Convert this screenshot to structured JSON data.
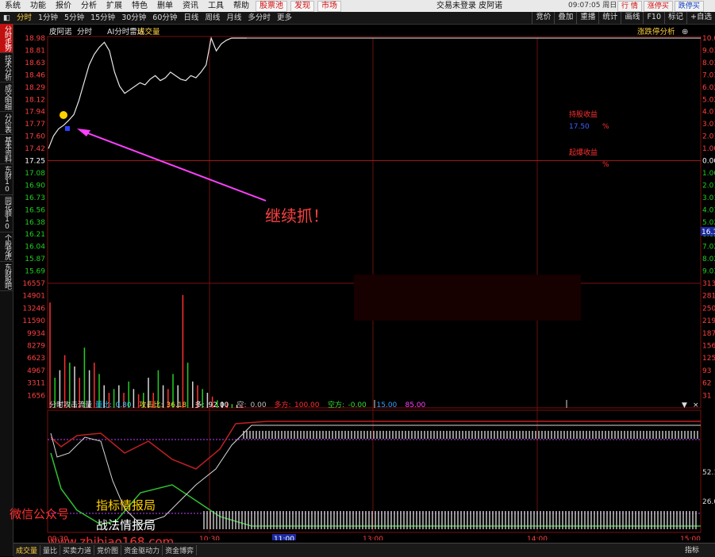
{
  "menu": [
    "系统",
    "功能",
    "报价",
    "分析",
    "扩展",
    "特色",
    "删单",
    "资讯",
    "工具",
    "帮助"
  ],
  "menu_highlights": [
    "股票池",
    "发现",
    "市场"
  ],
  "window_title": "交易未登录  皮阿诺",
  "clock": "09:07:05 周日",
  "window_buttons": [
    "行 情",
    "涨停买",
    "跌停买"
  ],
  "toolbar": [
    "分时",
    "1分钟",
    "5分钟",
    "15分钟",
    "30分钟",
    "60分钟",
    "日线",
    "周线",
    "月线",
    "多分时",
    "更多"
  ],
  "toolbar_right": [
    "竞价",
    "叠加",
    "重播",
    "统计",
    "画线",
    "F10",
    "标记",
    "+自选"
  ],
  "sidebar": [
    "分时走势",
    "技术分析",
    "成交明细",
    "分价表",
    "基本资料",
    "东财10",
    "同花顺10",
    "个股龙虎",
    "东财股吧"
  ],
  "header": {
    "stock": "皮阿诺",
    "labels": [
      "分时",
      "AI分时雷达",
      "成交量"
    ],
    "right_label": "涨跌停分析"
  },
  "price_axis": {
    "left": [
      "18.98",
      "18.81",
      "18.63",
      "18.46",
      "18.29",
      "18.12",
      "17.94",
      "17.77",
      "17.60",
      "17.42",
      "17.25",
      "17.08",
      "16.90",
      "16.73",
      "16.56",
      "16.38",
      "16.21",
      "16.04",
      "15.87",
      "15.69"
    ],
    "right": [
      "10.0",
      "9.03",
      "8.03",
      "7.03",
      "6.02",
      "5.02",
      "4.01",
      "3.01",
      "2.01",
      "1.00",
      "0.00",
      "1.00",
      "2.01",
      "3.01",
      "4.01",
      "5.02",
      "6.02",
      "7.02",
      "8.02",
      "9.03"
    ],
    "prev_close": "17.25",
    "cursor_label": "16.1"
  },
  "volume_axis": {
    "left": [
      "16557",
      "14901",
      "13246",
      "11590",
      "9934",
      "8279",
      "6623",
      "4967",
      "3311",
      "1656"
    ],
    "right": [
      "313",
      "281",
      "250",
      "219",
      "187",
      "156",
      "125",
      "93",
      "62",
      "31"
    ]
  },
  "annotations": {
    "cost_label": "持股收益",
    "cost_value": "17.50",
    "cost_pct": "%",
    "rise_label": "起爆收益",
    "rise_pct": "%",
    "overlay": "继续抓！"
  },
  "indicator": {
    "title": "分时攻击流量",
    "items": [
      {
        "label": "量比:",
        "value": "0.80",
        "color": "#30c8ff"
      },
      {
        "label": "攻击比:",
        "value": "36.18",
        "color": "#ffd040"
      },
      {
        "label": "多:",
        "value": "92.00",
        "color": "#ffffff"
      },
      {
        "label": "空:",
        "value": "0.00",
        "color": "#c0c0c0"
      },
      {
        "label": "多方:",
        "value": "100.00",
        "color": "#ff3030"
      },
      {
        "label": "空方:",
        "value": "-0.00",
        "color": "#30e030"
      },
      {
        "label": "",
        "value": "15.00",
        "color": "#30a0ff"
      },
      {
        "label": "",
        "value": "85.00",
        "color": "#ff40ff"
      }
    ],
    "right_axis": [
      "52.1",
      "26.0"
    ]
  },
  "time_axis": [
    "09:30",
    "10:30",
    "11:00",
    "13:00",
    "14:00",
    "15:00"
  ],
  "bottom_tabs": [
    "成交量",
    "量比",
    "买卖力道",
    "竞价图",
    "资金驱动力",
    "资金博弈"
  ],
  "indicator_button": "指标",
  "watermark": {
    "prefix": "微信公众号",
    "line1": "指标情报局",
    "line2": "战法情报局",
    "url": "www.zhibiao168.com"
  },
  "chart_data": {
    "type": "line",
    "ylim": [
      15.52,
      18.98
    ],
    "prev_close": 17.25,
    "price_series": [
      17.42,
      17.6,
      17.7,
      17.75,
      17.82,
      17.9,
      18.1,
      18.35,
      18.6,
      18.75,
      18.85,
      18.92,
      18.8,
      18.5,
      18.3,
      18.2,
      18.25,
      18.3,
      18.35,
      18.32,
      18.4,
      18.45,
      18.38,
      18.42,
      18.5,
      18.45,
      18.4,
      18.38,
      18.45,
      18.42,
      18.5,
      18.6,
      18.98,
      18.8,
      18.9,
      18.95,
      18.98,
      18.98,
      18.98,
      18.98
    ],
    "volume_series": [
      14000,
      4000,
      5000,
      7000,
      6000,
      5500,
      4000,
      8000,
      5000,
      6000,
      4500,
      3000,
      2000,
      2500,
      3000,
      2000,
      3500,
      2500,
      1800,
      2000,
      4000,
      2000,
      5000,
      3000,
      2500,
      4500,
      3000,
      15000,
      6000,
      3500,
      3000,
      2500,
      2000,
      1500,
      1000,
      800,
      600,
      500,
      400,
      300
    ]
  }
}
